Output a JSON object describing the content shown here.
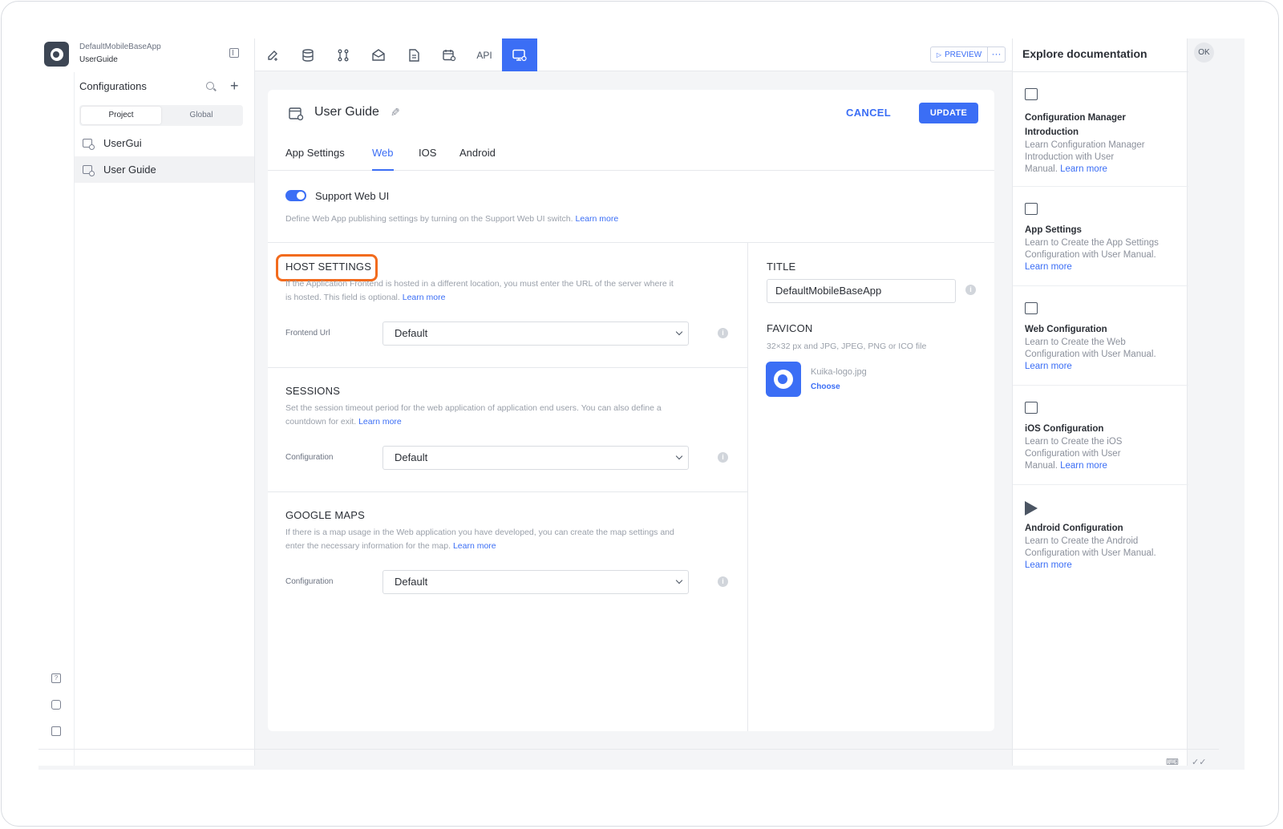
{
  "app": {
    "name": "DefaultMobileBaseApp",
    "subtitle": "UserGuide"
  },
  "sidebar": {
    "title": "Configurations",
    "segments": [
      "Project",
      "Global"
    ],
    "active_segment": "Project",
    "items": [
      {
        "label": "UserGui",
        "selected": false
      },
      {
        "label": "User Guide",
        "selected": true
      }
    ]
  },
  "toolbar": {
    "icons": [
      "design-icon",
      "database-icon",
      "workflow-icon",
      "mail-icon",
      "document-icon",
      "calendar-icon",
      "api-icon",
      "configuration-icon"
    ],
    "api_label": "API",
    "active": "configuration-icon",
    "preview_label": "PREVIEW",
    "more_label": "···"
  },
  "editor": {
    "title": "User Guide",
    "cancel_label": "CANCEL",
    "update_label": "UPDATE",
    "tabs": [
      "App Settings",
      "Web",
      "IOS",
      "Android"
    ],
    "active_tab": "Web",
    "support_web_ui": {
      "label": "Support Web UI",
      "enabled": true,
      "hint": "Define Web App publishing settings by turning on the Support Web UI switch.",
      "link": "Learn more"
    },
    "host_settings": {
      "title": "HOST SETTINGS",
      "hint_line1": "If the Application Frontend is hosted in a different location, you must enter the URL of the server where it",
      "hint_line2": "is hosted. This field is optional.",
      "link": "Learn more",
      "field_label": "Frontend Url",
      "value": "Default"
    },
    "sessions": {
      "title": "SESSIONS",
      "hint_line1": "Set the session timeout period for the web application of application end users. You can also define a",
      "hint_line2": "countdown for exit.",
      "link": "Learn more",
      "field_label": "Configuration",
      "value": "Default"
    },
    "google_maps": {
      "title": "GOOGLE MAPS",
      "hint_line1": "If there is a map usage in the Web application you have developed, you can create the map settings and",
      "hint_line2": "enter the necessary information for the map.",
      "link": "Learn more",
      "field_label": "Configuration",
      "value": "Default"
    },
    "title_field": {
      "label": "TITLE",
      "value": "DefaultMobileBaseApp"
    },
    "favicon": {
      "label": "FAVICON",
      "hint": "32×32 px and JPG, JPEG, PNG or ICO file",
      "file_name": "Kuika-logo.jpg",
      "choose_label": "Choose"
    },
    "info_glyph": "i"
  },
  "docs": {
    "title": "Explore documentation",
    "avatar_initials": "OK",
    "items": [
      {
        "title_line1": "Configuration Manager",
        "title_line2": "Introduction",
        "desc_line1": "Learn Configuration Manager",
        "desc_line2": "Introduction with User",
        "desc_line3": "Manual.",
        "link": "Learn more",
        "icon": "configuration-icon"
      },
      {
        "title_line1": "App Settings",
        "desc_line1": "Learn to Create the App Settings",
        "desc_line2": "Configuration with User Manual.",
        "link": "Learn more",
        "icon": "configuration-icon"
      },
      {
        "title_line1": "Web Configuration",
        "desc_line1": "Learn to Create the Web",
        "desc_line2": "Configuration with User Manual.",
        "link": "Learn more",
        "icon": "web-icon"
      },
      {
        "title_line1": "iOS Configuration",
        "desc_line1": "Learn to Create the iOS",
        "desc_line2": "Configuration with User",
        "desc_line3": "Manual.",
        "link": "Learn more",
        "icon": "app-store-icon"
      },
      {
        "title_line1": "Android Configuration",
        "desc_line1": "Learn to Create the Android",
        "desc_line2": "Configuration with User Manual.",
        "link": "Learn more",
        "icon": "play-store-icon"
      }
    ]
  },
  "colors": {
    "accent": "#3b6ef5",
    "highlight": "#f26b1d"
  }
}
